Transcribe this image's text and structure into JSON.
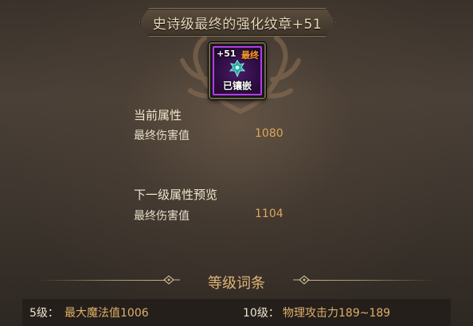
{
  "title": "史诗级最终的强化纹章+51",
  "item_icon": {
    "plus_label": "+51",
    "final_label": "最终",
    "embedded_label": "已镶嵌",
    "icon": "crest-icon",
    "border_color": "#b23cf0"
  },
  "current": {
    "heading": "当前属性",
    "attr_name": "最终伤害值",
    "attr_value": "1080"
  },
  "next": {
    "heading": "下一级属性预览",
    "attr_name": "最终伤害值",
    "attr_value": "1104"
  },
  "level_entries": {
    "heading": "等级词条",
    "items": [
      {
        "level": "5级：",
        "value": "最大魔法值1006"
      },
      {
        "level": "10级：",
        "value": "物理攻击力189~189"
      }
    ]
  },
  "colors": {
    "value_gold": "#d9a85a",
    "heading_gold": "#e0b475",
    "epic_purple": "#b23cf0"
  }
}
